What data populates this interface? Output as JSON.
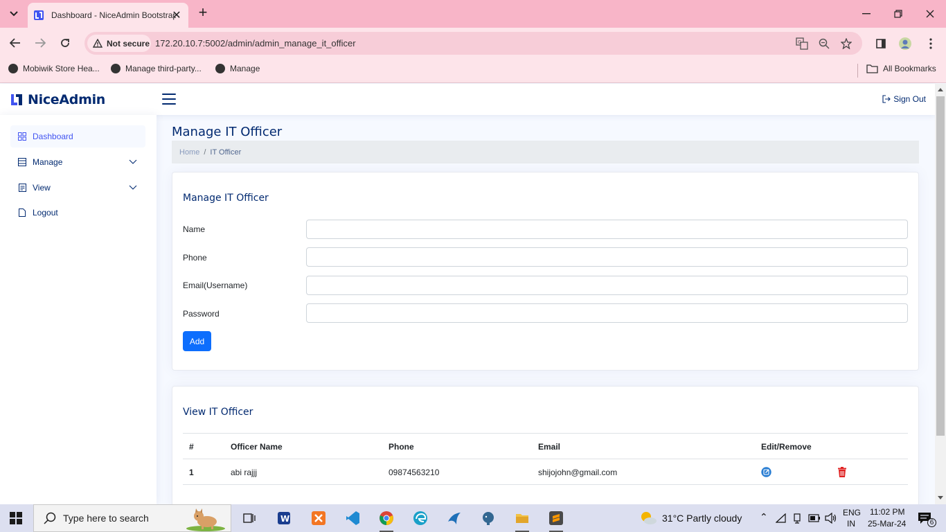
{
  "browser": {
    "tab_title": "Dashboard - NiceAdmin Bootstrap",
    "security_label": "Not secure",
    "url": "172.20.10.7:5002/admin/admin_manage_it_officer",
    "bookmarks": [
      {
        "label": "Mobiwik Store Hea..."
      },
      {
        "label": "Manage third-party..."
      },
      {
        "label": "Manage"
      }
    ],
    "all_bookmarks_label": "All Bookmarks"
  },
  "header": {
    "logo_text": "NiceAdmin",
    "signout_label": "Sign Out"
  },
  "sidebar": {
    "items": [
      {
        "label": "Dashboard"
      },
      {
        "label": "Manage"
      },
      {
        "label": "View"
      },
      {
        "label": "Logout"
      }
    ]
  },
  "page": {
    "title": "Manage IT Officer",
    "breadcrumb": {
      "home": "Home",
      "sep": "/",
      "current": "IT Officer"
    }
  },
  "form_card": {
    "title": "Manage IT Officer",
    "fields": [
      {
        "label": "Name",
        "value": ""
      },
      {
        "label": "Phone",
        "value": ""
      },
      {
        "label": "Email(Username)",
        "value": ""
      },
      {
        "label": "Password",
        "value": ""
      }
    ],
    "add_label": "Add"
  },
  "view_card": {
    "title": "View IT Officer",
    "columns": [
      "#",
      "Officer Name",
      "Phone",
      "Email",
      "Edit/Remove"
    ],
    "rows": [
      {
        "num": "1",
        "name": "abi rajjj",
        "phone": "09874563210",
        "email": "shijojohn@gmail.com"
      }
    ]
  },
  "taskbar": {
    "search_placeholder": "Type here to search",
    "weather": "31°C  Partly cloudy",
    "lang_top": "ENG",
    "lang_bottom": "IN",
    "time": "11:02 PM",
    "date": "25-Mar-24",
    "notif_count": "6"
  },
  "colors": {
    "brand": "#012970",
    "accent": "#4154f1",
    "primary_button": "#0d6efd",
    "edit_icon": "#2a7ed3",
    "delete_icon": "#e02020",
    "browser_chrome": "#f8b5c8"
  }
}
